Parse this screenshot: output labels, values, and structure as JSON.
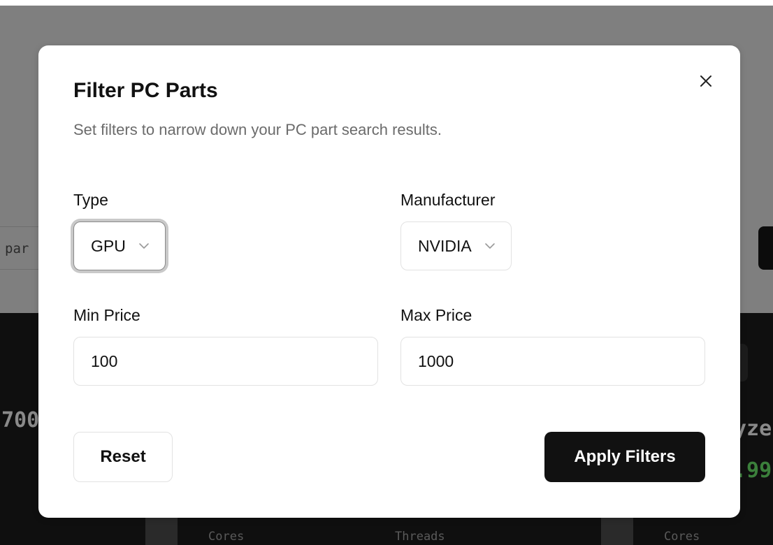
{
  "background": {
    "search_partial_text": "par",
    "card_left_title_partial": "700",
    "card_right_title_partial": "yze",
    "card_right_price_partial": ".99",
    "stat_labels": [
      "Cores",
      "Threads",
      "Cores"
    ]
  },
  "modal": {
    "title": "Filter PC Parts",
    "description": "Set filters to narrow down your PC part search results.",
    "close_icon": "close-icon",
    "fields": {
      "type": {
        "label": "Type",
        "value": "GPU"
      },
      "manufacturer": {
        "label": "Manufacturer",
        "value": "NVIDIA"
      },
      "min_price": {
        "label": "Min Price",
        "value": "100"
      },
      "max_price": {
        "label": "Max Price",
        "value": "1000"
      }
    },
    "reset_label": "Reset",
    "apply_label": "Apply Filters"
  },
  "colors": {
    "overlay": "#808080",
    "primary_button": "#111111",
    "muted_text": "#6b6b6b",
    "price_green": "#3b7f3b"
  }
}
